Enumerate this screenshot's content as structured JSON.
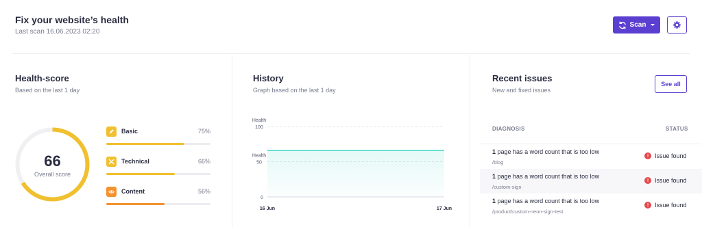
{
  "header": {
    "title": "Fix your website’s health",
    "last_scan": "Last scan 16.06.2023 02:20",
    "scan_label": "Scan"
  },
  "health": {
    "title": "Health-score",
    "subtitle": "Based on the last 1 day",
    "score": "66",
    "score_value": 66,
    "score_label": "Overall score",
    "metrics": [
      {
        "label": "Basic",
        "percent": "75%",
        "value": 75,
        "color": "#f0c02f"
      },
      {
        "label": "Technical",
        "percent": "66%",
        "value": 66,
        "color": "#f0c02f"
      },
      {
        "label": "Content",
        "percent": "56%",
        "value": 56,
        "color": "#f3922f"
      }
    ]
  },
  "history": {
    "title": "History",
    "subtitle": "Graph based on the last 1 day"
  },
  "chart_data": {
    "type": "area",
    "x": [
      "16 Jun",
      "17 Jun"
    ],
    "series": [
      {
        "values": [
          66,
          66
        ]
      }
    ],
    "ylabel": "Health",
    "ylim": [
      0,
      100
    ],
    "yticks": [
      0,
      50,
      100
    ],
    "tick_labels": {
      "y": [
        "Health 100",
        "Health 50",
        "0"
      ],
      "x": [
        "16 Jun",
        "17 Jun"
      ]
    },
    "line_color": "#3fd6c6",
    "grid": true
  },
  "issues": {
    "title": "Recent issues",
    "subtitle": "New and fixed issues",
    "see_all": "See all",
    "col_diagnosis": "DIAGNOSIS",
    "col_status": "STATUS",
    "rows": [
      {
        "count": "1",
        "text": "page has a word count that is too low",
        "path": "/blog",
        "status": "Issue found"
      },
      {
        "count": "1",
        "text": "page has a word count that is too low",
        "path": "/custom-sign",
        "status": "Issue found"
      },
      {
        "count": "1",
        "text": "page has a word count that is too low",
        "path": "/product/custom-neon-sign-test",
        "status": "Issue found"
      }
    ]
  },
  "colors": {
    "accent": "#5b3fd1",
    "gauge": "#f0c02f",
    "issue": "#e5484d"
  },
  "icons": {
    "scan": "refresh-icon",
    "settings": "gear-icon",
    "basic": "pencil-icon",
    "technical": "tools-icon",
    "content": "eye-icon",
    "status": "exclamation-icon"
  }
}
